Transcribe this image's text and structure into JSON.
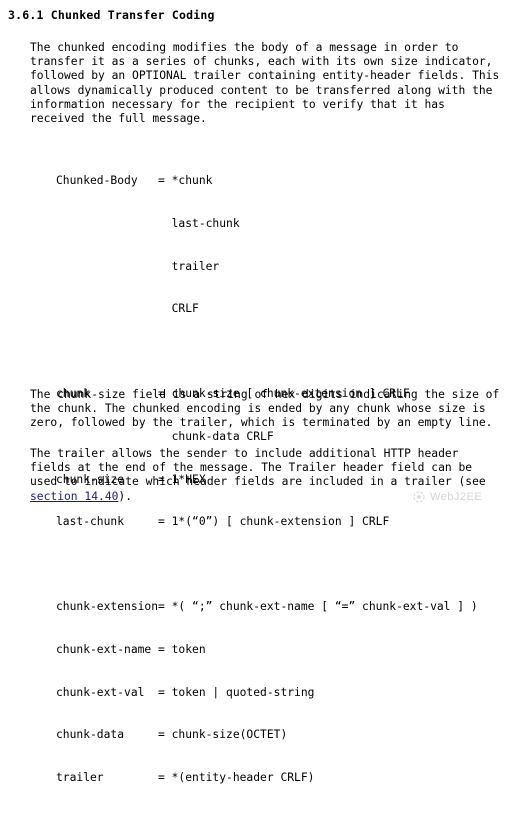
{
  "document": {
    "section_number": "3.6.1",
    "title": "3.6.1 Chunked Transfer Coding",
    "background_color": "#ffffff",
    "text_color": "#000000",
    "link_color": "#1a1a8c"
  },
  "paragraphs": {
    "intro": "The chunked encoding modifies the body of a message in order to\ntransfer it as a series of chunks, each with its own size indicator,\nfollowed by an OPTIONAL trailer containing entity-header fields. This\nallows dynamically produced content to be transferred along with the\ninformation necessary for the recipient to verify that it has\nreceived the full message.",
    "chunk_size_note": "The chunk-size field is a string of hex digits indicating the size of\nthe chunk. The chunked encoding is ended by any chunk whose size is\nzero, followed by the trailer, which is terminated by an empty line.",
    "trailer_note_before_link": "The trailer allows the sender to include additional HTTP header\nfields at the end of the message. The Trailer header field can be\nused to indicate which header fields are included in a trailer (see\n",
    "trailer_note_link": "section 14.40",
    "trailer_note_after_link": ")."
  },
  "grammar": {
    "lines": [
      "Chunked-Body   = *chunk",
      "                 last-chunk",
      "                 trailer",
      "                 CRLF",
      "",
      "chunk          = chunk-size [ chunk-extension ] CRLF",
      "                 chunk-data CRLF",
      "chunk-size     = 1*HEX",
      "last-chunk     = 1*(“0”) [ chunk-extension ] CRLF",
      "",
      "chunk-extension= *( “;” chunk-ext-name [ “=” chunk-ext-val ] )",
      "chunk-ext-name = token",
      "chunk-ext-val  = token | quoted-string",
      "chunk-data     = chunk-size(OCTET)",
      "trailer        = *(entity-header CRLF)"
    ]
  },
  "watermark": {
    "text": "WebJ2EE",
    "color": "#9a9a9a"
  }
}
